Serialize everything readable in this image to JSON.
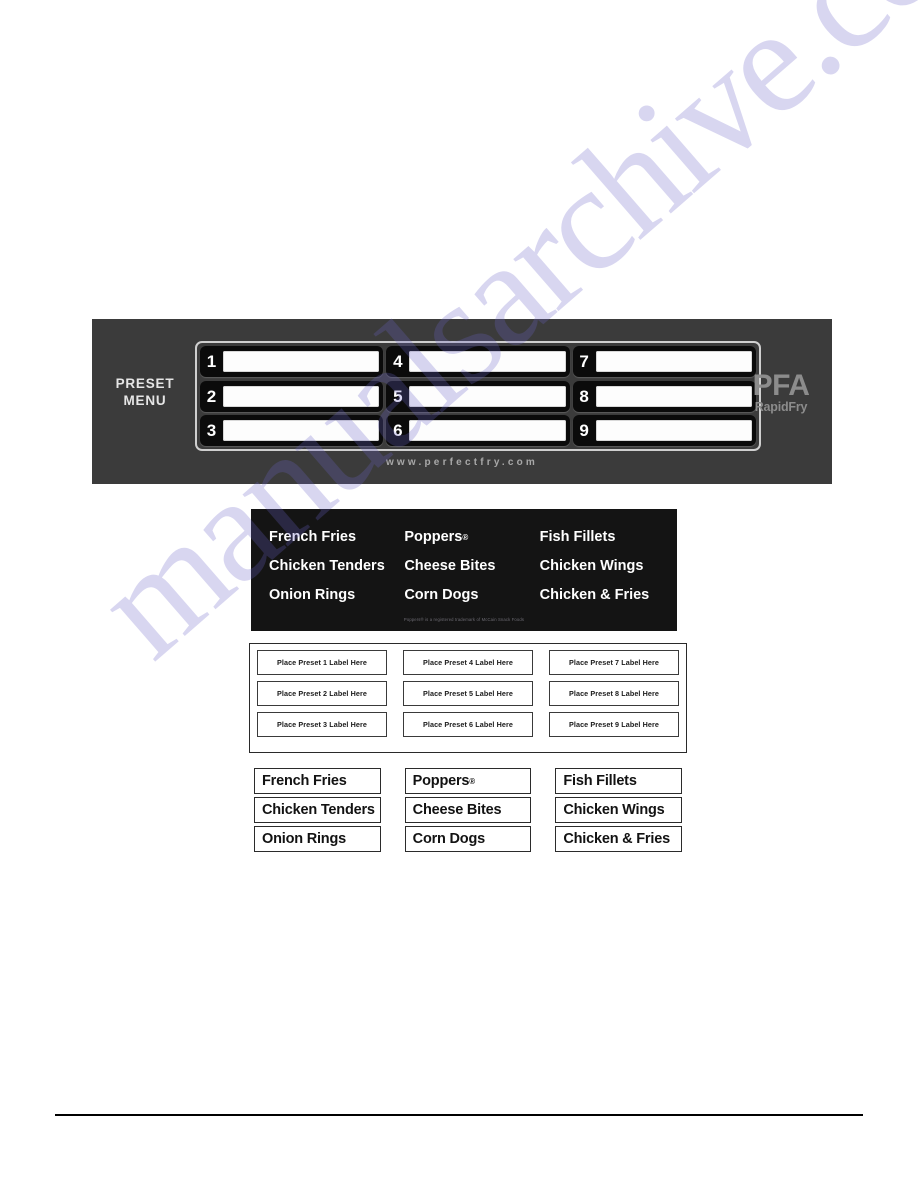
{
  "watermark": {
    "text": "manualsarchive.com",
    "color": "#6a63c8"
  },
  "control_panel": {
    "preset_label_line1": "PRESET",
    "preset_label_line2": "MENU",
    "url": "www.perfectfry.com",
    "brand_main": "PFA",
    "brand_sub": "RapidFry",
    "background_color": "#3b3b3b",
    "key_color": "#0b0b0b",
    "columns": [
      {
        "keys": [
          {
            "number": "1"
          },
          {
            "number": "2"
          },
          {
            "number": "3"
          }
        ]
      },
      {
        "keys": [
          {
            "number": "4"
          },
          {
            "number": "5"
          },
          {
            "number": "6"
          }
        ]
      },
      {
        "keys": [
          {
            "number": "7"
          },
          {
            "number": "8"
          },
          {
            "number": "9"
          }
        ]
      }
    ]
  },
  "menu_card": {
    "background_color": "#141414",
    "columns": [
      {
        "items": [
          "French Fries",
          "Chicken Tenders",
          "Onion Rings"
        ]
      },
      {
        "items": [
          "Poppers",
          "Cheese Bites",
          "Corn Dogs"
        ]
      },
      {
        "items": [
          "Fish Fillets",
          "Chicken Wings",
          "Chicken & Fries"
        ]
      }
    ],
    "poppers_has_registered_mark": true,
    "footnote": "Poppers® is a registered trademark of  McCain Snack Foods"
  },
  "blank_sheet": {
    "columns": [
      {
        "labels": [
          "Place Preset 1 Label Here",
          "Place Preset 2 Label Here",
          "Place Preset 3 Label Here"
        ]
      },
      {
        "labels": [
          "Place Preset 4 Label Here",
          "Place Preset 5 Label Here",
          "Place Preset 6 Label Here"
        ]
      },
      {
        "labels": [
          "Place Preset 7 Label Here",
          "Place Preset 8 Label Here",
          "Place Preset 9 Label Here"
        ]
      }
    ]
  },
  "printed_labels": {
    "columns": [
      {
        "labels": [
          "French Fries",
          "Chicken Tenders",
          "Onion Rings"
        ]
      },
      {
        "labels": [
          "Poppers",
          "Cheese Bites",
          "Corn Dogs"
        ]
      },
      {
        "labels": [
          "Fish Fillets",
          "Chicken Wings",
          "Chicken & Fries"
        ]
      }
    ],
    "poppers_has_registered_mark": true
  }
}
